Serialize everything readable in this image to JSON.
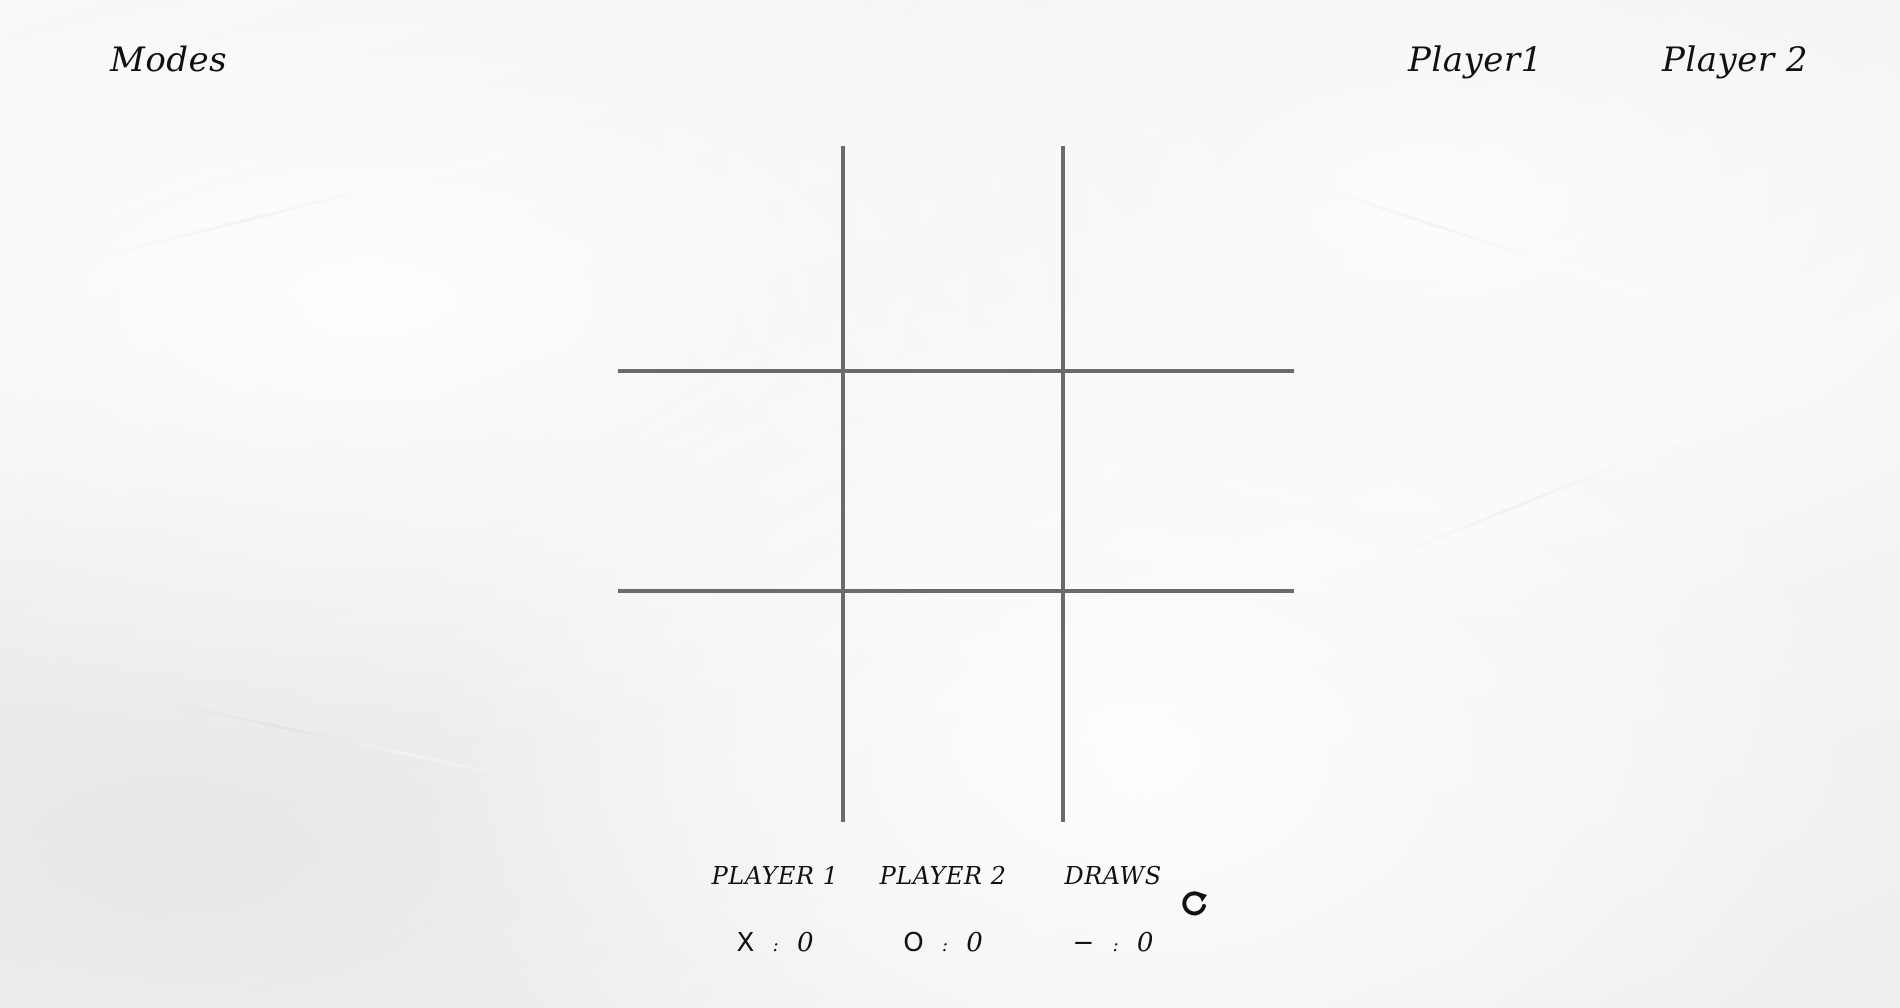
{
  "nav": {
    "modes_label": "Modes",
    "player1_label": "Player1",
    "player2_label": "Player 2"
  },
  "board": {
    "cells": [
      "",
      "",
      "",
      "",
      "",
      "",
      "",
      "",
      ""
    ]
  },
  "scoreboard": {
    "player1": {
      "label": "PLAYER 1",
      "symbol": "X",
      "separator": ":",
      "score": "0"
    },
    "player2": {
      "label": "PLAYER 2",
      "symbol": "O",
      "separator": ":",
      "score": "0"
    },
    "draws": {
      "label": "DRAWS",
      "symbol": "−",
      "separator": ":",
      "score": "0"
    }
  },
  "restart_icon": "restart-icon",
  "colors": {
    "grid_line": "#6b6b6b",
    "text": "#111111",
    "paper": "#f4f4f4"
  }
}
